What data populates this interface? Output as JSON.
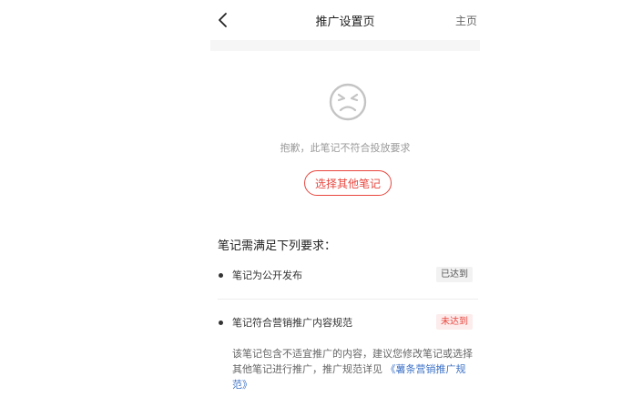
{
  "header": {
    "back_icon": "chevron-left-icon",
    "title": "推广设置页",
    "home_label": "主页"
  },
  "empty_state": {
    "icon": "sad-face-icon",
    "message": "抱歉，此笔记不符合投放要求",
    "button_label": "选择其他笔记"
  },
  "requirements": {
    "title": "笔记需满足下列要求：",
    "items": [
      {
        "label": "笔记为公开发布",
        "status": "已达到"
      },
      {
        "label": "笔记符合营销推广内容规范",
        "status": "未达到",
        "note": "该笔记包含不适宜推广的内容，建议您修改笔记或选择其他笔记进行推广，推广规范详见",
        "note_link": "《薯条营销推广规范》"
      }
    ]
  },
  "colors": {
    "accent": "#e8473f",
    "link": "#3d72c7",
    "muted_text": "#9a9a9a"
  }
}
